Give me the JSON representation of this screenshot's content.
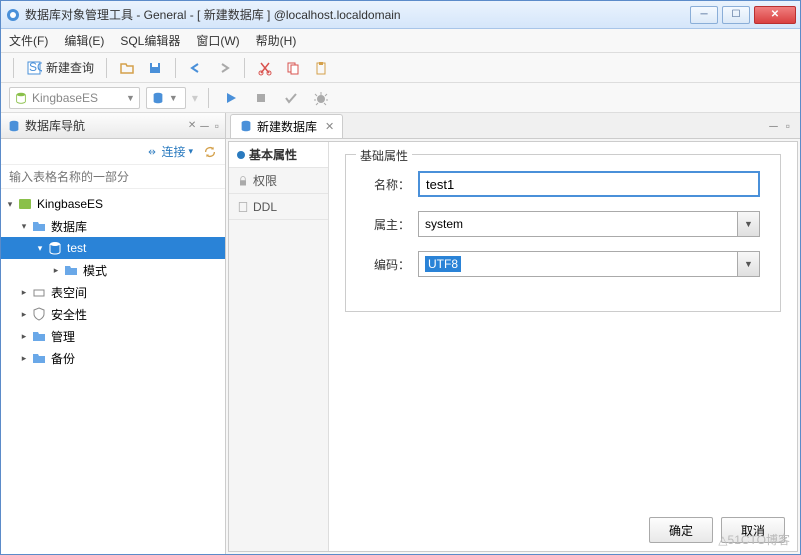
{
  "title": "数据库对象管理工具 - General - [ 新建数据库 ] @localhost.localdomain",
  "menus": {
    "file": "文件(F)",
    "edit": "编辑(E)",
    "sql": "SQL编辑器",
    "window": "窗口(W)",
    "help": "帮助(H)"
  },
  "toolbar": {
    "new_query": "新建查询"
  },
  "combo": {
    "connection": "KingbaseES"
  },
  "left_panel": {
    "title": "数据库导航",
    "connect_label": "连接",
    "filter_placeholder": "输入表格名称的一部分"
  },
  "tree": {
    "root": "KingbaseES",
    "databases": "数据库",
    "test": "test",
    "schema": "模式",
    "tablespaces": "表空间",
    "security": "安全性",
    "management": "管理",
    "backup": "备份"
  },
  "editor": {
    "tab_title": "新建数据库",
    "sidebar": {
      "basic": "基本属性",
      "permissions": "权限",
      "ddl": "DDL"
    },
    "fieldset_title": "基础属性",
    "labels": {
      "name": "名称：",
      "owner": "属主：",
      "encoding": "编码："
    },
    "values": {
      "name": "test1",
      "owner": "system",
      "encoding": "UTF8"
    },
    "buttons": {
      "ok": "确定",
      "cancel": "取消"
    }
  },
  "watermark": "△51CTO博客"
}
